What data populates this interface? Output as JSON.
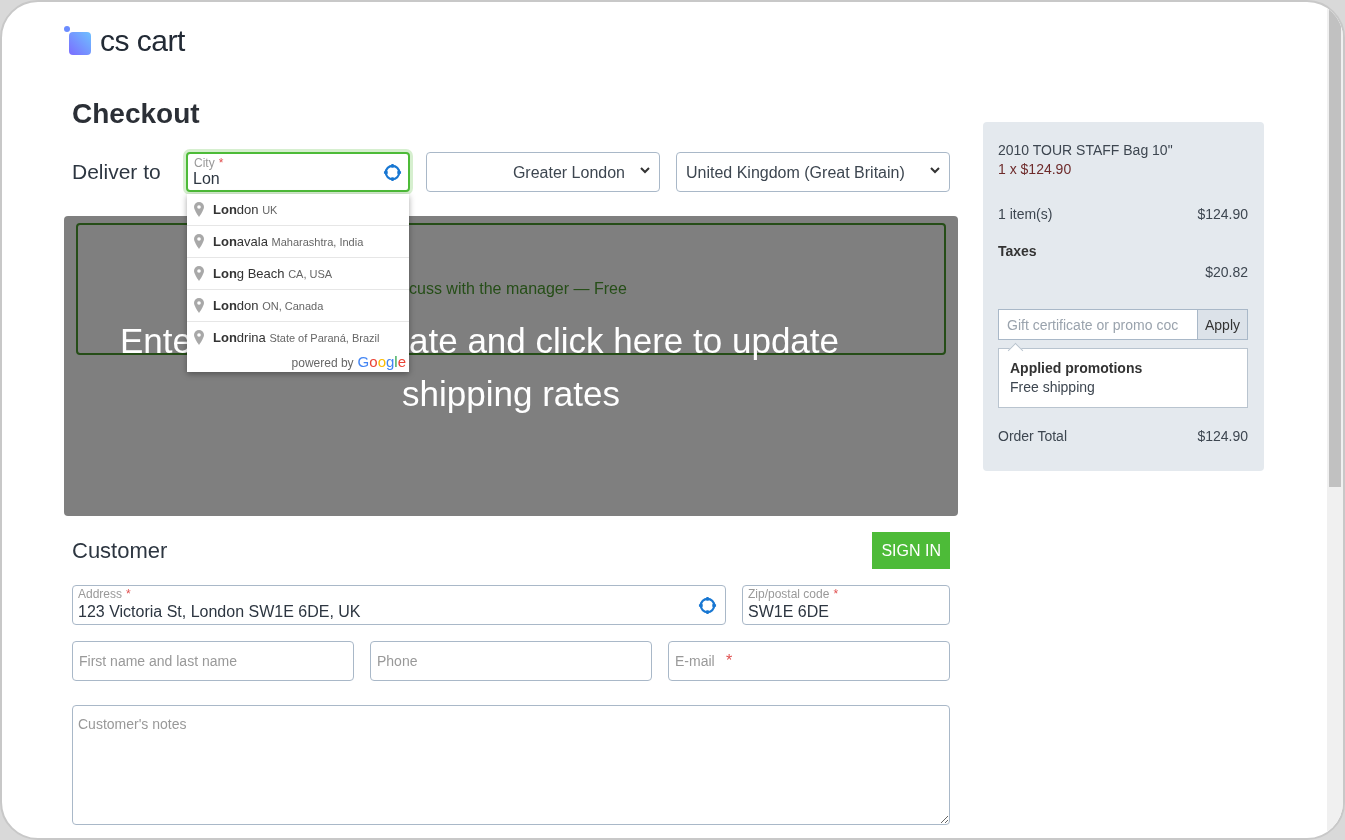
{
  "logo": {
    "text": "cs cart"
  },
  "title": "Checkout",
  "deliver": {
    "label": "Deliver to",
    "city": {
      "label": "City",
      "required_mark": "*",
      "value": "Lon",
      "focused": true
    },
    "state": {
      "value": "Greater London"
    },
    "country": {
      "value": "United Kingdom (Great Britain)"
    }
  },
  "suggestions": {
    "items": [
      {
        "name": "**Lon**don",
        "detail": "UK"
      },
      {
        "name": "**Lon**avala",
        "detail": "Maharashtra, India"
      },
      {
        "name": "**Lon**g Beach",
        "detail": "CA, USA"
      },
      {
        "name": "**Lon**don",
        "detail": "ON, Canada"
      },
      {
        "name": "**Lon**drina",
        "detail": "State of Paraná, Brazil"
      }
    ],
    "footer": "powered by",
    "brand": "Google"
  },
  "shipping": {
    "visible_text": "cuss with the manager — Free"
  },
  "overlay": {
    "line_1_parts": [
      "Ente",
      "ate and click here to update"
    ],
    "line_2": "shipping rates"
  },
  "customer": {
    "title": "Customer",
    "sign_in": "SIGN IN",
    "filled_fields": [
      {
        "label": "Address",
        "required_mark": "*",
        "value": "123 Victoria St, London SW1E 6DE, UK",
        "kind": "locate"
      },
      {
        "label": "Zip/postal code",
        "required_mark": "*",
        "value": "SW1E 6DE",
        "kind": "plain"
      }
    ],
    "empty_fields": [
      {
        "placeholder": "First name and last name"
      },
      {
        "placeholder": "Phone"
      },
      {
        "placeholder": "E-mail",
        "required_mark": "*"
      }
    ],
    "notes": {
      "placeholder": "Customer's notes"
    }
  },
  "summary": {
    "product": "2010 TOUR STAFF Bag 10\"",
    "quantity": "1 x $124.90",
    "items_label": "1 item(s)",
    "items_value": "$124.90",
    "taxes_label": "Taxes",
    "taxes_value": "$20.82",
    "promo": {
      "placeholder": "Gift certificate or promo coc",
      "button": "Apply"
    },
    "promotions": {
      "title": "Applied promotions",
      "items": [
        "Free shipping"
      ]
    },
    "total_label": "Order Total",
    "total_value": "$124.90"
  }
}
